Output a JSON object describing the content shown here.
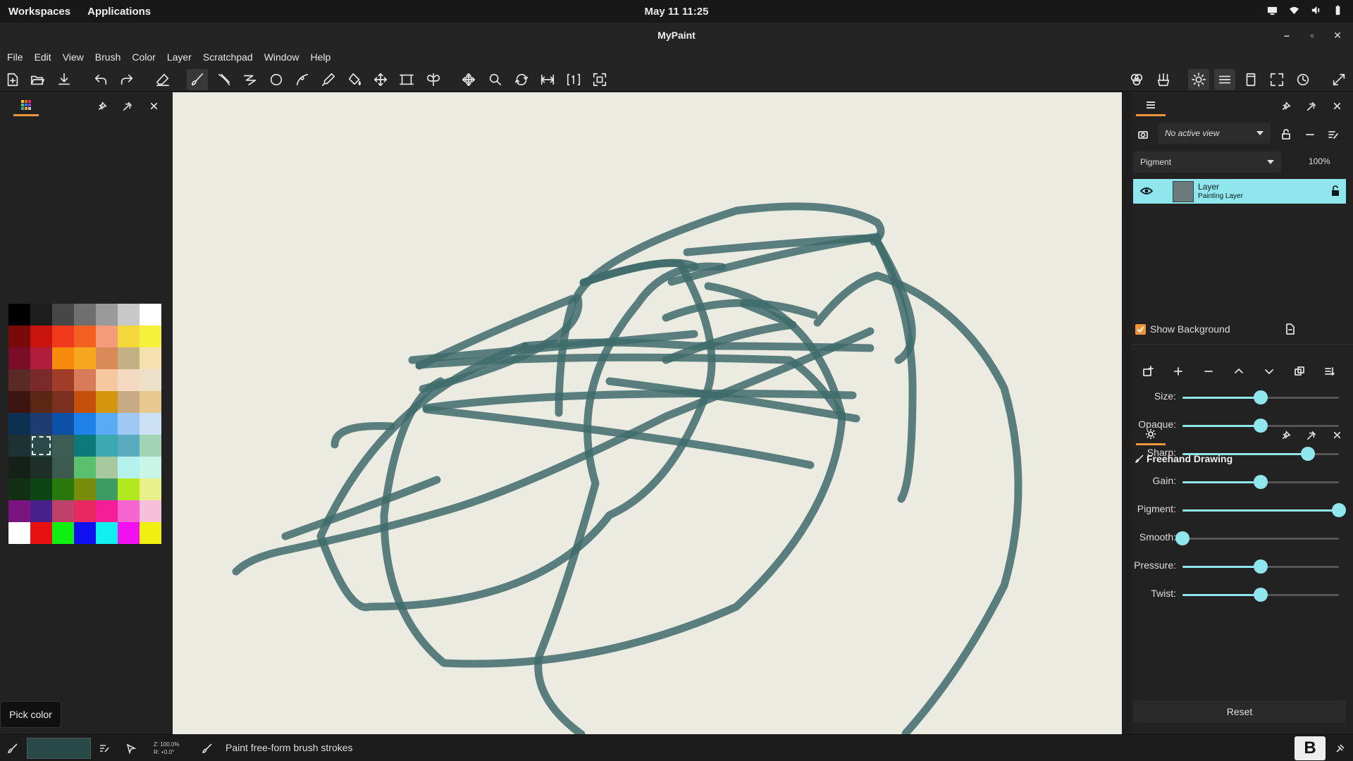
{
  "system_bar": {
    "workspaces": "Workspaces",
    "applications": "Applications",
    "clock": "May 11  11:25",
    "tray_icons": [
      "display-icon",
      "wifi-icon",
      "volume-icon",
      "battery-icon"
    ]
  },
  "window": {
    "title": "MyPaint",
    "controls": [
      "minimize",
      "maximize",
      "close"
    ]
  },
  "menubar": {
    "items": [
      "File",
      "Edit",
      "View",
      "Brush",
      "Color",
      "Layer",
      "Scratchpad",
      "Window",
      "Help"
    ]
  },
  "toolbar": {
    "tools": [
      "new-file-icon",
      "open-file-icon",
      "save-file-icon",
      "undo-icon",
      "redo-icon",
      "eraser-icon",
      "brush-icon",
      "inking-icon",
      "connected-lines-icon",
      "ellipse-icon",
      "bezier-icon",
      "color-picker-icon",
      "fill-icon",
      "move-layer-icon",
      "frame-icon",
      "symmetry-icon",
      "pan-icon",
      "zoom-icon",
      "rotate-icon",
      "mirror-icon",
      "reset-view-icon",
      "fit-view-icon"
    ],
    "active_tool": "brush-icon",
    "right_tools": [
      "color-wheel-icon",
      "brush-settings-icon",
      "preferences-icon",
      "layers-panel-icon",
      "scratchpad-icon",
      "fullscreen-icon",
      "history-icon",
      "expand-icon"
    ]
  },
  "left_panel": {
    "active_tab": "palette-icon",
    "controls": [
      "pin-icon",
      "detach-icon",
      "close-icon"
    ],
    "palette": [
      "#000000",
      "#1e1e1e",
      "#474747",
      "#6f6f6f",
      "#9a9a9a",
      "#c8c8c8",
      "#ffffff",
      "#7a0a0a",
      "#c8140c",
      "#f0391c",
      "#f46020",
      "#f49b7a",
      "#f5d63b",
      "#f5f03b",
      "#7a0d28",
      "#b01e3c",
      "#f58a0c",
      "#f5a81e",
      "#d98a58",
      "#c2b184",
      "#f5e0b0",
      "#5c2a26",
      "#7a2a2a",
      "#a03c28",
      "#d97a5a",
      "#f5c8a0",
      "#f5d8c0",
      "#ede0c8",
      "#3c1410",
      "#5c2614",
      "#7a3020",
      "#c4500c",
      "#d4960c",
      "#c8aa84",
      "#e8c890",
      "#0c3050",
      "#1e3c72",
      "#0c50a8",
      "#1e82e8",
      "#5aaaf5",
      "#a0c8f5",
      "#cce0f5",
      "#1e3236",
      "#2a4a4a",
      "#3c5c54",
      "#0c7a7a",
      "#3ca8b0",
      "#5aaac0",
      "#a0d4b4",
      "#142018",
      "#1e2e28",
      "#3c5a50",
      "#5ac06e",
      "#a8c8a0",
      "#b4f0ec",
      "#c8f5e8",
      "#143014",
      "#0c4414",
      "#28780c",
      "#7a8c0c",
      "#3c9c64",
      "#b4e81e",
      "#e8f08c",
      "#7a1480",
      "#48208c",
      "#c0406c",
      "#e82860",
      "#f51e96",
      "#f564d0",
      "#f5c0d8",
      "#ffffff",
      "#e81010",
      "#10f010",
      "#1010f0",
      "#10f0f0",
      "#f010f0",
      "#f0f010"
    ],
    "selected_swatch_index": 43,
    "tooltip": "Pick color"
  },
  "right_panel": {
    "layers": {
      "active_tab": "layers-icon",
      "controls": [
        "pin-icon",
        "detach-icon",
        "close-icon"
      ],
      "view_dropdown": "No active view",
      "view_buttons": [
        "snapshot-icon",
        "lock-view-icon",
        "remove-view-icon",
        "edit-view-icon"
      ],
      "blend_mode": "Pigment",
      "opacity": "100%",
      "layer": {
        "name": "Layer",
        "type": "Painting Layer",
        "visible": true
      },
      "layer_buttons": [
        "add-group-icon",
        "add-layer-icon",
        "remove-layer-icon",
        "move-up-icon",
        "move-down-icon",
        "duplicate-icon",
        "merge-down-icon"
      ],
      "show_background_label": "Show Background",
      "show_background": true
    },
    "brush": {
      "active_tab": "gear-icon",
      "title": "Freehand Drawing",
      "sliders": [
        {
          "label": "Size:",
          "value": 0.5
        },
        {
          "label": "Opaque:",
          "value": 0.5
        },
        {
          "label": "Sharp:",
          "value": 0.8
        },
        {
          "label": "Gain:",
          "value": 0.5
        },
        {
          "label": "Pigment:",
          "value": 1.0
        },
        {
          "label": "Smooth:",
          "value": 0.0
        },
        {
          "label": "Pressure:",
          "value": 0.5
        },
        {
          "label": "Twist:",
          "value": 0.5
        }
      ],
      "reset_label": "Reset"
    }
  },
  "status_bar": {
    "zoom_line": "Z: 100.0%",
    "rotation_line": "R: +0.0°",
    "message": "Paint free-form brush strokes",
    "brush_color": "#2a4a4a"
  },
  "colors": {
    "accent": "#f0943b",
    "highlight": "#8fe6ec",
    "canvas": "#ecebe2",
    "stroke": "#3f6b6b"
  }
}
